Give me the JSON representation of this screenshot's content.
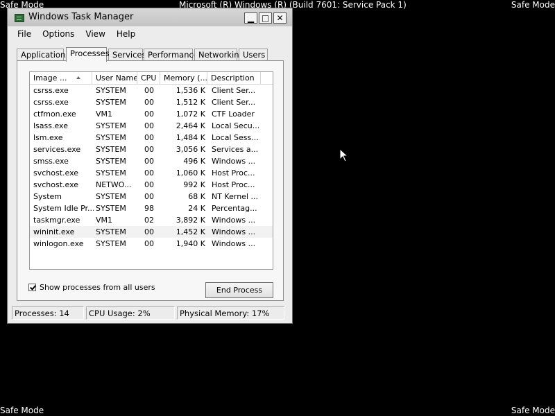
{
  "desktop": {
    "safe_mode_label": "Safe Mode",
    "build_text": "Microsoft (R) Windows (R) (Build 7601: Service Pack 1)"
  },
  "window": {
    "title": "Windows Task Manager",
    "controls": {
      "minimize": "▁",
      "maximize": "□",
      "close": "✕"
    }
  },
  "menu": [
    "File",
    "Options",
    "View",
    "Help"
  ],
  "tabs": [
    {
      "label": "Applications",
      "active": false
    },
    {
      "label": "Processes",
      "active": true
    },
    {
      "label": "Services",
      "active": false
    },
    {
      "label": "Performance",
      "active": false
    },
    {
      "label": "Networking",
      "active": false
    },
    {
      "label": "Users",
      "active": false
    }
  ],
  "processes": {
    "columns": [
      "Image ...",
      "User Name",
      "CPU",
      "Memory (...",
      "Description"
    ],
    "rows": [
      {
        "name": "csrss.exe",
        "user": "SYSTEM",
        "cpu": "00",
        "mem": "1,536 K",
        "desc": "Client Ser..."
      },
      {
        "name": "csrss.exe",
        "user": "SYSTEM",
        "cpu": "00",
        "mem": "1,512 K",
        "desc": "Client Ser..."
      },
      {
        "name": "ctfmon.exe",
        "user": "VM1",
        "cpu": "00",
        "mem": "1,072 K",
        "desc": "CTF Loader"
      },
      {
        "name": "lsass.exe",
        "user": "SYSTEM",
        "cpu": "00",
        "mem": "2,464 K",
        "desc": "Local Secu..."
      },
      {
        "name": "lsm.exe",
        "user": "SYSTEM",
        "cpu": "00",
        "mem": "1,484 K",
        "desc": "Local Sess..."
      },
      {
        "name": "services.exe",
        "user": "SYSTEM",
        "cpu": "00",
        "mem": "3,056 K",
        "desc": "Services a..."
      },
      {
        "name": "smss.exe",
        "user": "SYSTEM",
        "cpu": "00",
        "mem": "496 K",
        "desc": "Windows ..."
      },
      {
        "name": "svchost.exe",
        "user": "SYSTEM",
        "cpu": "00",
        "mem": "1,060 K",
        "desc": "Host Proc..."
      },
      {
        "name": "svchost.exe",
        "user": "NETWO...",
        "cpu": "00",
        "mem": "992 K",
        "desc": "Host Proc..."
      },
      {
        "name": "System",
        "user": "SYSTEM",
        "cpu": "00",
        "mem": "68 K",
        "desc": "NT Kernel ..."
      },
      {
        "name": "System Idle Pr...",
        "user": "SYSTEM",
        "cpu": "98",
        "mem": "24 K",
        "desc": "Percentag..."
      },
      {
        "name": "taskmgr.exe",
        "user": "VM1",
        "cpu": "02",
        "mem": "3,892 K",
        "desc": "Windows ..."
      },
      {
        "name": "wininit.exe",
        "user": "SYSTEM",
        "cpu": "00",
        "mem": "1,452 K",
        "desc": "Windows ..."
      },
      {
        "name": "winlogon.exe",
        "user": "SYSTEM",
        "cpu": "00",
        "mem": "1,940 K",
        "desc": "Windows ..."
      }
    ],
    "highlighted_row": 12
  },
  "controls": {
    "show_all_label": "Show processes from all users",
    "show_all_checked": true,
    "end_process_label": "End Process"
  },
  "status": {
    "processes": "Processes: 14",
    "cpu": "CPU Usage: 2%",
    "memory": "Physical Memory: 17%"
  }
}
